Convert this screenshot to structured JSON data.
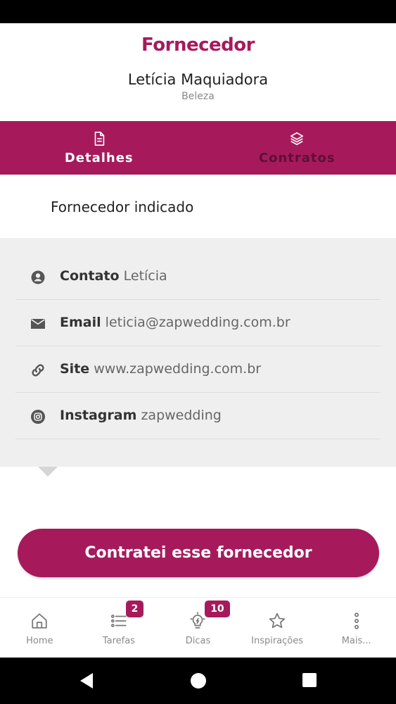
{
  "header": {
    "title": "Fornecedor",
    "vendor_name": "Letícia Maquiadora",
    "vendor_category": "Beleza"
  },
  "tabs": [
    {
      "label": "Detalhes",
      "icon": "document-icon",
      "active": true
    },
    {
      "label": "Contratos",
      "icon": "layers-icon",
      "active": false
    }
  ],
  "indicated_label": "Fornecedor indicado",
  "info": [
    {
      "label": "Contato",
      "value": "Letícia",
      "icon": "user-circle-icon"
    },
    {
      "label": "Email",
      "value": "leticia@zapwedding.com.br",
      "icon": "mail-icon"
    },
    {
      "label": "Site",
      "value": "www.zapwedding.com.br",
      "icon": "link-icon"
    },
    {
      "label": "Instagram",
      "value": "zapwedding",
      "icon": "instagram-icon"
    }
  ],
  "cta_label": "Contratei esse fornecedor",
  "bottom_nav": [
    {
      "label": "Home",
      "icon": "home-icon"
    },
    {
      "label": "Tarefas",
      "icon": "task-list-icon",
      "badge": "2"
    },
    {
      "label": "Dicas",
      "icon": "lightbulb-icon",
      "badge": "10"
    },
    {
      "label": "Inspirações",
      "icon": "star-icon"
    },
    {
      "label": "Mais...",
      "icon": "more-vertical-icon"
    }
  ],
  "colors": {
    "brand": "#a61a5c",
    "tab_inactive_text": "#5e0f35",
    "panel_bg": "#efeff0"
  }
}
